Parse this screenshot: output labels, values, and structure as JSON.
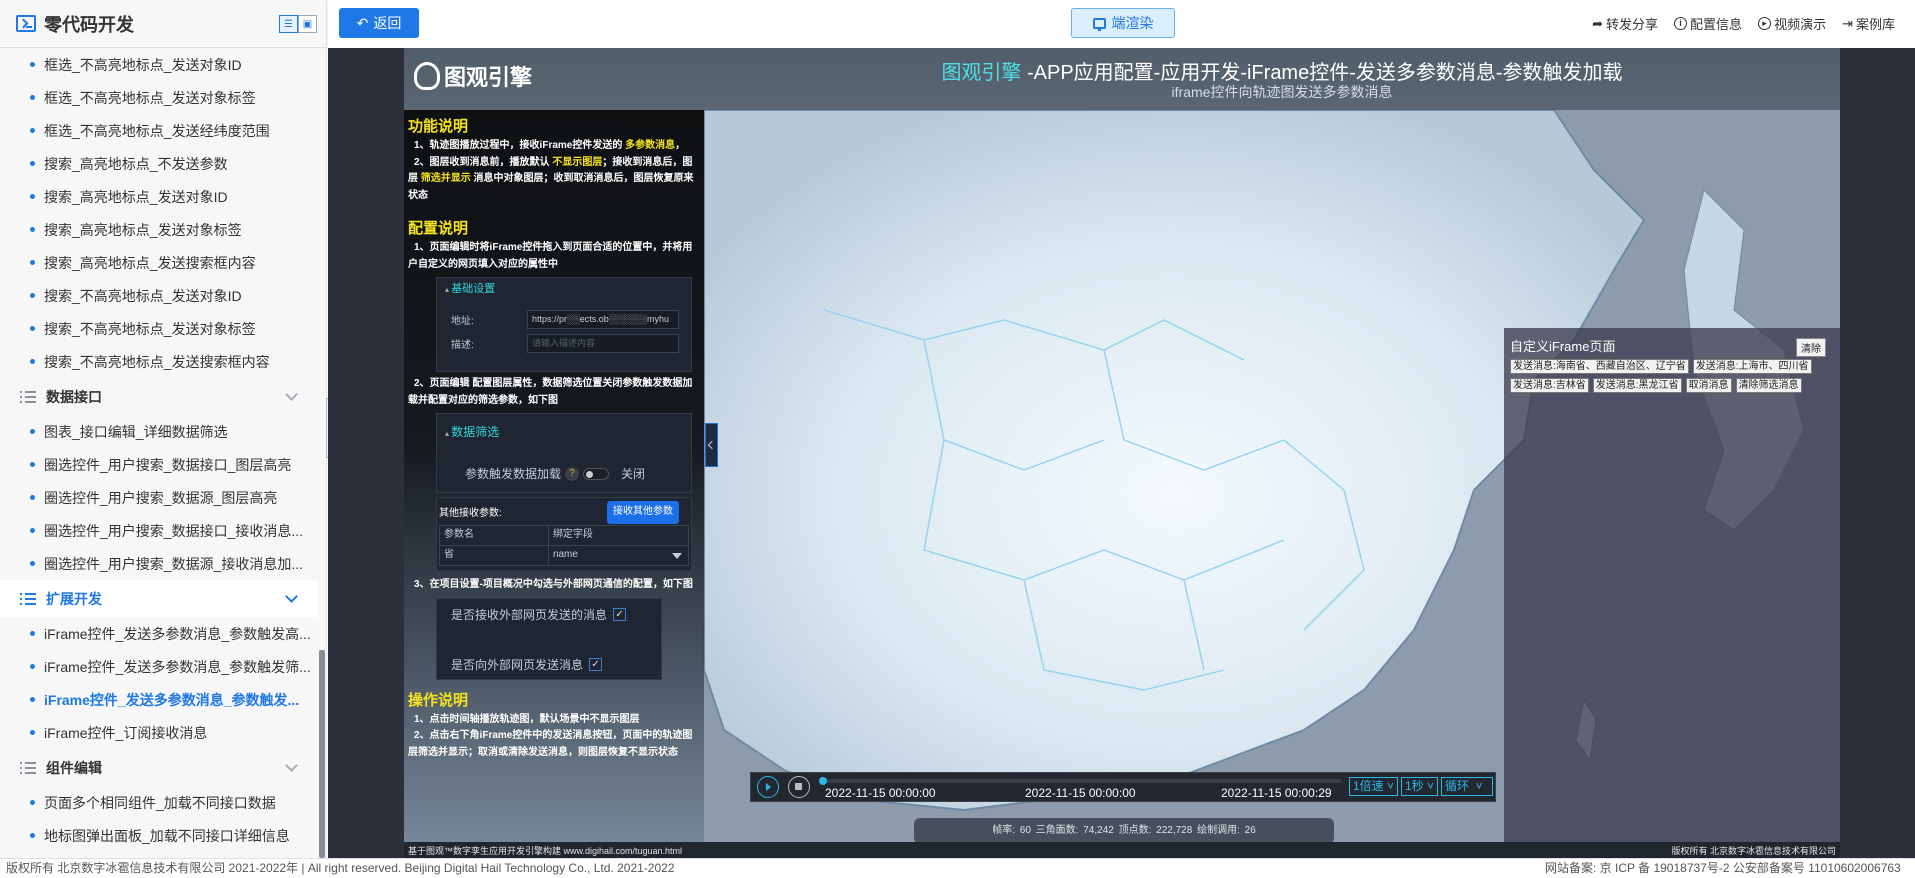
{
  "sidebar": {
    "title": "零代码开发",
    "view_toggle": [
      "list-view",
      "card-view"
    ],
    "items": [
      {
        "type": "item",
        "label": "框选_不高亮地标点_发送对象ID"
      },
      {
        "type": "item",
        "label": "框选_不高亮地标点_发送对象标签"
      },
      {
        "type": "item",
        "label": "框选_不高亮地标点_发送经纬度范围"
      },
      {
        "type": "item",
        "label": "搜索_高亮地标点_不发送参数"
      },
      {
        "type": "item",
        "label": "搜索_高亮地标点_发送对象ID"
      },
      {
        "type": "item",
        "label": "搜索_高亮地标点_发送对象标签"
      },
      {
        "type": "item",
        "label": "搜索_高亮地标点_发送搜索框内容"
      },
      {
        "type": "item",
        "label": "搜索_不高亮地标点_发送对象ID"
      },
      {
        "type": "item",
        "label": "搜索_不高亮地标点_发送对象标签"
      },
      {
        "type": "item",
        "label": "搜索_不高亮地标点_发送搜索框内容"
      },
      {
        "type": "group",
        "label": "数据接口",
        "open": false
      },
      {
        "type": "item",
        "label": "图表_接口编辑_详细数据筛选"
      },
      {
        "type": "item",
        "label": "圈选控件_用户搜索_数据接口_图层高亮"
      },
      {
        "type": "item",
        "label": "圈选控件_用户搜索_数据源_图层高亮"
      },
      {
        "type": "item",
        "label": "圈选控件_用户搜索_数据接口_接收消息..."
      },
      {
        "type": "item",
        "label": "圈选控件_用户搜索_数据源_接收消息加..."
      },
      {
        "type": "group",
        "label": "扩展开发",
        "open": true
      },
      {
        "type": "item",
        "label": "iFrame控件_发送多参数消息_参数触发高..."
      },
      {
        "type": "item",
        "label": "iFrame控件_发送多参数消息_参数触发筛..."
      },
      {
        "type": "item",
        "label": "iFrame控件_发送多参数消息_参数触发...",
        "active": true
      },
      {
        "type": "item",
        "label": "iFrame控件_订阅接收消息"
      },
      {
        "type": "group",
        "label": "组件编辑",
        "open": false
      },
      {
        "type": "item",
        "label": "页面多个相同组件_加载不同接口数据"
      },
      {
        "type": "item",
        "label": "地标图弹出面板_加载不同接口详细信息"
      }
    ]
  },
  "topbar": {
    "back_label": "返回",
    "render_label": "端渲染",
    "actions": [
      {
        "icon": "share-icon",
        "label": "转发分享"
      },
      {
        "icon": "info-icon",
        "label": "配置信息"
      },
      {
        "icon": "play-circle-icon",
        "label": "视频演示"
      },
      {
        "icon": "exit-icon",
        "label": "案例库"
      }
    ]
  },
  "scene": {
    "brand": "图观引擎",
    "title_highlight": "图观引擎",
    "title_rest": " -APP应用配置-应用开发-iFrame控件-发送多参数消息-参数触发加载",
    "subtitle": "iframe控件向轨迹图发送多参数消息",
    "info": {
      "func_title": "功能说明",
      "func_1a": "1、轨迹图播放过程中，接收iFrame控件发送的 ",
      "func_1hl": "多参数消息",
      "func_1b": "，",
      "func_2a": "2、图层收到消息前，播放默认 ",
      "func_2hl1": "不显示图层",
      "func_2b": "；接收到消息后，图层 ",
      "func_2hl2": "筛选并显示",
      "func_2c": " 消息中对象图层；收到取消消息后，图层恢复原来状态",
      "cfg_title": "配置说明",
      "cfg_1": "1、页面编辑时将iFrame控件拖入到页面合适的位置中，并将用户自定义的网页填入对应的属性中",
      "basic_settings": "基础设置",
      "addr_label": "地址:",
      "addr_value": "https://pr░░ects.ob░░░░░░myhu",
      "desc_label": "描述:",
      "desc_placeholder": "请输入描述内容",
      "cfg_2": "2、页面编辑 配置图层属性，数据筛选位置关闭参数触发数据加载并配置对应的筛选参数，如下图",
      "data_filter": "数据筛选",
      "param_trigger": "参数触发数据加载",
      "param_trigger_help": "?",
      "param_trigger_state": "关闭",
      "other_params": "其他接收参数:",
      "recv_other_btn": "接收其他参数",
      "param_table_headers": [
        "参数名",
        "绑定字段"
      ],
      "param_table_rows": [
        [
          "省",
          "name"
        ]
      ],
      "cfg_3": "3、在项目设置-项目概况中勾选与外部网页通信的配置，如下图",
      "chk_recv": "是否接收外部网页发送的消息",
      "chk_send": "是否向外部网页发送消息",
      "ops_title": "操作说明",
      "ops_1": "1、点击时间轴播放轨迹图，默认场景中不显示图层",
      "ops_2": "2、点击右下角iFrame控件中的发送消息按钮，页面中的轨迹图层筛选并显示；取消或清除发送消息，则图层恢复不显示状态"
    },
    "iframe_panel": {
      "title": "自定义iFrame页面",
      "clear": "清除",
      "buttons": [
        "发送消息:海南省、西藏自治区、辽宁省",
        "发送消息:上海市、四川省",
        "发送消息:吉林省",
        "发送消息:黑龙江省",
        "取消消息",
        "清除筛选消息"
      ]
    },
    "timeline": {
      "start": "2022-11-15 00:00:00",
      "current": "2022-11-15 00:00:00",
      "end": "2022-11-15 00:00:29",
      "progress": 0,
      "speed": "1倍速",
      "interval": "1秒",
      "mode": "循环"
    },
    "stats": "帧率: 60    三角面数: 74,242    顶点数: 222,728    绘制调用: 26",
    "foot_left": "基于图观™数字孪生应用开发引擎构建 www.digihail.com/tuguan.html",
    "foot_right": "版权所有 北京数字冰雹信息技术有限公司"
  },
  "footer": {
    "left": "版权所有 北京数字冰雹信息技术有限公司 2021-2022年 | All right reserved. Beijing Digital Hail Technology Co., Ltd. 2021-2022",
    "right": "网站备案: 京 ICP 备 19018737号-2 公安部备案号 11010602006763"
  }
}
